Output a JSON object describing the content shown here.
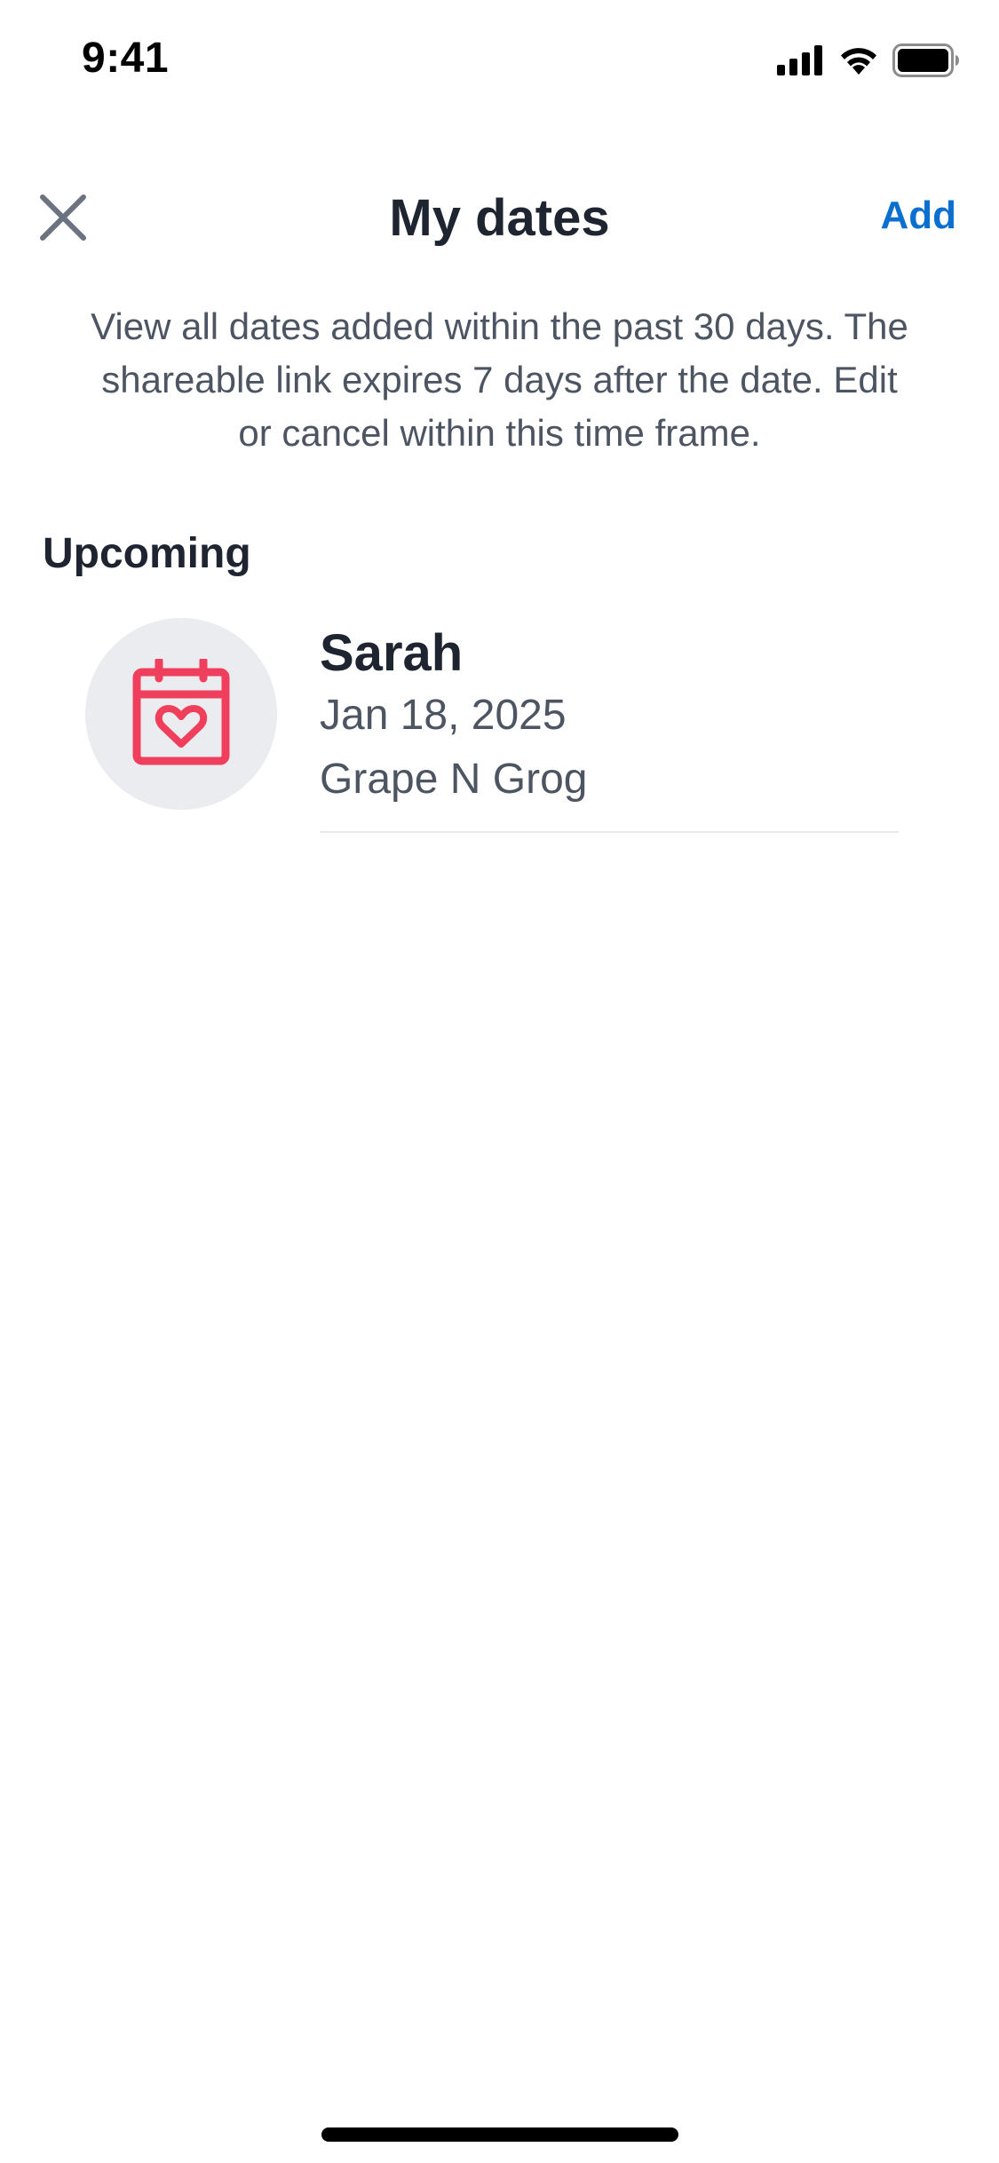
{
  "status_bar": {
    "time": "9:41"
  },
  "nav": {
    "title": "My dates",
    "add_label": "Add",
    "close_icon": "close-icon"
  },
  "description": "View all dates added within the past 30 days. The shareable link expires 7 days after the date. Edit or cancel within this time frame.",
  "sections": [
    {
      "heading": "Upcoming",
      "items": [
        {
          "name": "Sarah",
          "date": "Jan 18, 2025",
          "venue": "Grape N Grog",
          "icon": "calendar-heart-icon"
        }
      ]
    }
  ],
  "colors": {
    "accent": "#0b6fd0",
    "icon_red": "#f03f5c",
    "avatar_bg": "#ebecef",
    "text_primary": "#1f2530",
    "text_secondary": "#4d5562"
  }
}
